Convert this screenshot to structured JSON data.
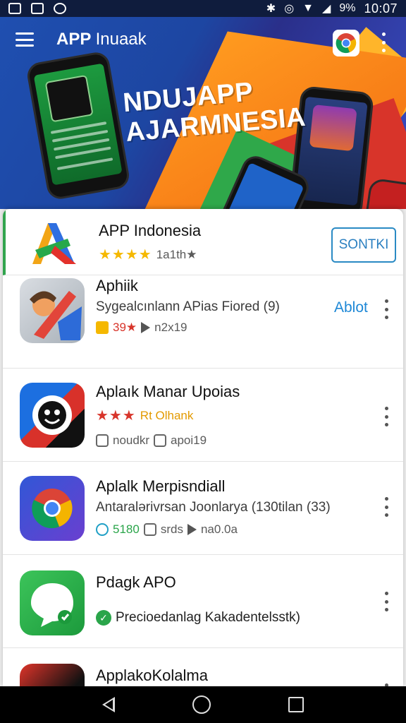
{
  "status_bar": {
    "battery": "9%",
    "time": "10:07"
  },
  "app_bar": {
    "title_bold": "APP",
    "title_thin": "Inuaak"
  },
  "hero": {
    "headline_line1": "NDUJAPP",
    "headline_line2": "AJARMNESIA"
  },
  "featured": {
    "name": "APP Indonesia",
    "stars": "★★★★",
    "rating_text": "1a1th★",
    "install_label": "SONTKI"
  },
  "apps": [
    {
      "name": "Aphiik",
      "description": "Sygealcınlann APias Fiored (9)",
      "action_label": "Ablot",
      "meta_badge": "39★",
      "meta_text": "n2x19"
    },
    {
      "name": "Aplaık Manar Upoias",
      "stars": "★★★",
      "rating_text": "Rt Olhank",
      "meta_text1": "noudkr",
      "meta_text2": "apoi19"
    },
    {
      "name": "Aplalk Merpisndiall",
      "description": "Antaralərivrsan Joonlarya (130tilan (33)",
      "meta_badge": "5180",
      "meta_text1": "srds",
      "meta_text2": "na0.0a"
    },
    {
      "name": "Pdagk APO",
      "description": "Precioedanlag Kakadentelsstk)"
    },
    {
      "name": "ApplakoKolalma"
    }
  ],
  "colors": {
    "status_bar": "#0f1c3d",
    "hero_blue": "#1f4fb0",
    "hero_orange": "#ff9a1f",
    "accent_blue": "#1e88d6",
    "accent_green": "#31a44d",
    "star_yellow": "#f5b800",
    "star_red": "#d8352b"
  }
}
